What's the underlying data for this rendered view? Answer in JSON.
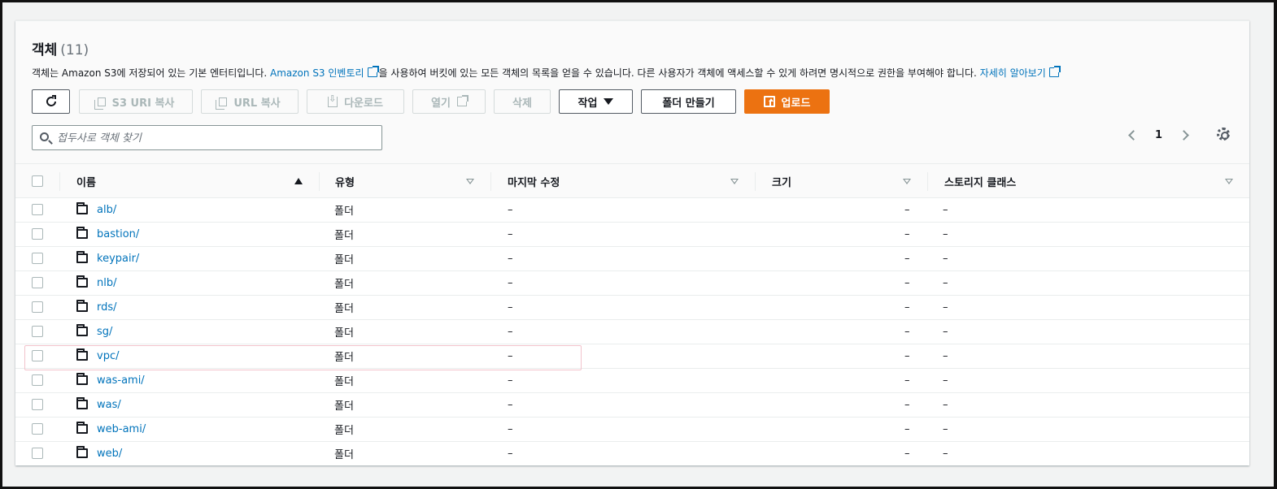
{
  "header": {
    "title": "객체",
    "count": "(11)",
    "desc_part1": "객체는 Amazon S3에 저장되어 있는 기본 엔터티입니다. ",
    "desc_link1": "Amazon S3 인벤토리",
    "desc_part2": "을 사용하여 버킷에 있는 모든 객체의 목록을 얻을 수 있습니다. 다른 사용자가 객체에 액세스할 수 있게 하려면 명시적으로 권한을 부여해야 합니다. ",
    "desc_link2": "자세히 알아보기"
  },
  "toolbar": {
    "copy_s3_uri": "S3 URI 복사",
    "copy_url": "URL 복사",
    "download": "다운로드",
    "open": "열기",
    "delete": "삭제",
    "actions": "작업",
    "create_folder": "폴더 만들기",
    "upload": "업로드"
  },
  "search": {
    "placeholder": "접두사로 객체 찾기",
    "value": ""
  },
  "pagination": {
    "page": "1"
  },
  "columns": {
    "name": "이름",
    "type": "유형",
    "last_modified": "마지막 수정",
    "size": "크기",
    "storage_class": "스토리지 클래스"
  },
  "rows": [
    {
      "name": "alb/",
      "type": "폴더",
      "modified": "–",
      "size": "–",
      "class": "–"
    },
    {
      "name": "bastion/",
      "type": "폴더",
      "modified": "–",
      "size": "–",
      "class": "–"
    },
    {
      "name": "keypair/",
      "type": "폴더",
      "modified": "–",
      "size": "–",
      "class": "–"
    },
    {
      "name": "nlb/",
      "type": "폴더",
      "modified": "–",
      "size": "–",
      "class": "–"
    },
    {
      "name": "rds/",
      "type": "폴더",
      "modified": "–",
      "size": "–",
      "class": "–"
    },
    {
      "name": "sg/",
      "type": "폴더",
      "modified": "–",
      "size": "–",
      "class": "–"
    },
    {
      "name": "vpc/",
      "type": "폴더",
      "modified": "–",
      "size": "–",
      "class": "–"
    },
    {
      "name": "was-ami/",
      "type": "폴더",
      "modified": "–",
      "size": "–",
      "class": "–"
    },
    {
      "name": "was/",
      "type": "폴더",
      "modified": "–",
      "size": "–",
      "class": "–"
    },
    {
      "name": "web-ami/",
      "type": "폴더",
      "modified": "–",
      "size": "–",
      "class": "–"
    },
    {
      "name": "web/",
      "type": "폴더",
      "modified": "–",
      "size": "–",
      "class": "–"
    }
  ],
  "colors": {
    "link": "#0073bb",
    "primary": "#ec7211",
    "highlight": "#f2c3cc"
  }
}
